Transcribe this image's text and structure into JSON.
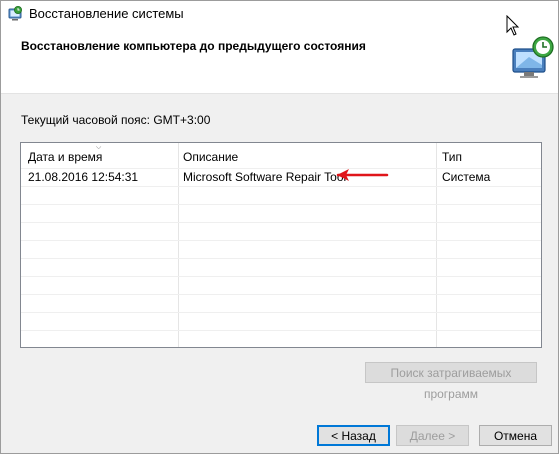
{
  "window": {
    "title": "Восстановление системы",
    "heading": "Восстановление компьютера до предыдущего состояния",
    "title_icon": "system-restore-icon",
    "header_icon": "restore-monitor-icon"
  },
  "timezone_label": "Текущий часовой пояс: GMT+3:00",
  "table": {
    "columns": [
      "Дата и время",
      "Описание",
      "Тип"
    ],
    "rows": [
      [
        "21.08.2016 12:54:31",
        "Microsoft Software Repair Tool",
        "Система"
      ]
    ],
    "annotation_arrow_color": "#e0151a"
  },
  "buttons": {
    "scan": "Поиск затрагиваемых программ",
    "back": "< Назад",
    "next": "Далее >",
    "cancel": "Отмена"
  },
  "colors": {
    "header_bg": "#ffffff",
    "body_bg": "#f0f0f0",
    "focus_border": "#0078d7"
  }
}
